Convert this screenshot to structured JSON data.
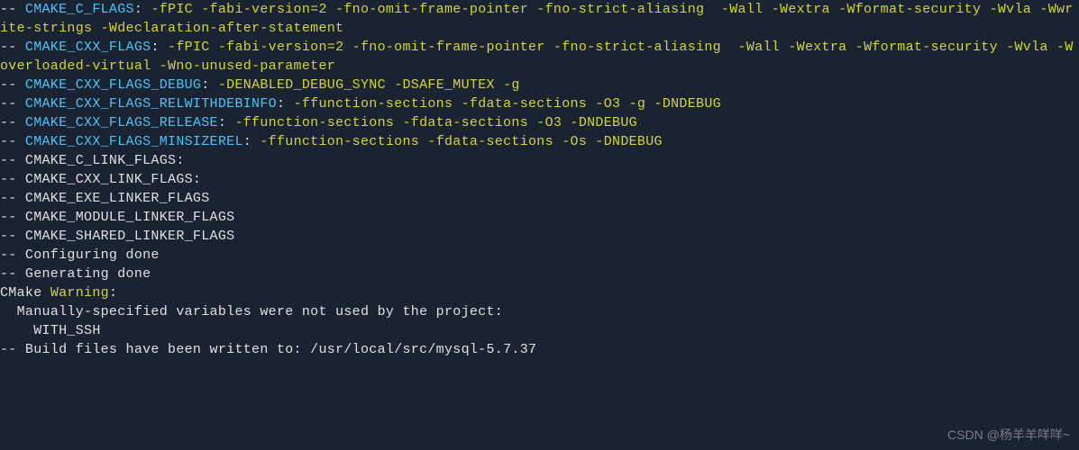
{
  "terminal": {
    "lines": [
      {
        "segments": [
          {
            "cls": "white",
            "t": "-- "
          },
          {
            "cls": "cyan",
            "t": "CMAKE_C_FLAGS"
          },
          {
            "cls": "white",
            "t": ": "
          },
          {
            "cls": "yellow",
            "t": "-fPIC -fabi-version=2 -fno-omit-frame-pointer -fno-strict-aliasing  -Wall -Wextra -Wformat-security -Wvla -Wwrite-strings -Wdeclaration-after-statement"
          }
        ]
      },
      {
        "segments": [
          {
            "cls": "white",
            "t": "-- "
          },
          {
            "cls": "cyan",
            "t": "CMAKE_CXX_FLAGS"
          },
          {
            "cls": "white",
            "t": ": "
          },
          {
            "cls": "yellow",
            "t": "-fPIC -fabi-version=2 -fno-omit-frame-pointer -fno-strict-aliasing  -Wall -Wextra -Wformat-security -Wvla -Woverloaded-virtual -Wno-unused-parameter"
          }
        ]
      },
      {
        "segments": [
          {
            "cls": "white",
            "t": "-- "
          },
          {
            "cls": "cyan",
            "t": "CMAKE_CXX_FLAGS_DEBUG"
          },
          {
            "cls": "white",
            "t": ": "
          },
          {
            "cls": "yellow",
            "t": "-DENABLED_DEBUG_SYNC -DSAFE_MUTEX -g"
          }
        ]
      },
      {
        "segments": [
          {
            "cls": "white",
            "t": "-- "
          },
          {
            "cls": "cyan",
            "t": "CMAKE_CXX_FLAGS_RELWITHDEBINFO"
          },
          {
            "cls": "white",
            "t": ": "
          },
          {
            "cls": "yellow",
            "t": "-ffunction-sections -fdata-sections -O3 -g -DNDEBUG"
          }
        ]
      },
      {
        "segments": [
          {
            "cls": "white",
            "t": "-- "
          },
          {
            "cls": "cyan",
            "t": "CMAKE_CXX_FLAGS_RELEASE"
          },
          {
            "cls": "white",
            "t": ": "
          },
          {
            "cls": "yellow",
            "t": "-ffunction-sections -fdata-sections -O3 -DNDEBUG"
          }
        ]
      },
      {
        "segments": [
          {
            "cls": "white",
            "t": "-- "
          },
          {
            "cls": "cyan",
            "t": "CMAKE_CXX_FLAGS_MINSIZEREL"
          },
          {
            "cls": "white",
            "t": ": "
          },
          {
            "cls": "yellow",
            "t": "-ffunction-sections -fdata-sections -Os -DNDEBUG"
          }
        ]
      },
      {
        "segments": [
          {
            "cls": "white",
            "t": "-- CMAKE_C_LINK_FLAGS: "
          }
        ]
      },
      {
        "segments": [
          {
            "cls": "white",
            "t": "-- CMAKE_CXX_LINK_FLAGS: "
          }
        ]
      },
      {
        "segments": [
          {
            "cls": "white",
            "t": "-- CMAKE_EXE_LINKER_FLAGS "
          }
        ]
      },
      {
        "segments": [
          {
            "cls": "white",
            "t": "-- CMAKE_MODULE_LINKER_FLAGS "
          }
        ]
      },
      {
        "segments": [
          {
            "cls": "white",
            "t": "-- CMAKE_SHARED_LINKER_FLAGS "
          }
        ]
      },
      {
        "segments": [
          {
            "cls": "white",
            "t": "-- Configuring done"
          }
        ]
      },
      {
        "segments": [
          {
            "cls": "white",
            "t": "-- Generating done"
          }
        ]
      },
      {
        "segments": [
          {
            "cls": "white",
            "t": "CMake "
          },
          {
            "cls": "yellow",
            "t": "Warning"
          },
          {
            "cls": "white",
            "t": ":"
          }
        ]
      },
      {
        "segments": [
          {
            "cls": "white",
            "t": "  Manually-specified variables were not used by the project:"
          }
        ]
      },
      {
        "segments": [
          {
            "cls": "white",
            "t": ""
          }
        ]
      },
      {
        "segments": [
          {
            "cls": "white",
            "t": "    WITH_SSH"
          }
        ]
      },
      {
        "segments": [
          {
            "cls": "white",
            "t": ""
          }
        ]
      },
      {
        "segments": [
          {
            "cls": "white",
            "t": ""
          }
        ]
      },
      {
        "segments": [
          {
            "cls": "white",
            "t": "-- Build files have been written to: /usr/local/src/mysql-5.7.37"
          }
        ]
      }
    ],
    "watermark": "CSDN @杨羊羊咩咩~"
  }
}
